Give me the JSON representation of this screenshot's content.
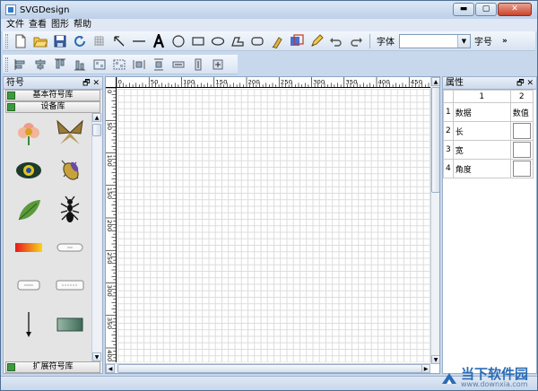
{
  "window": {
    "title": "SVGDesign",
    "min_glyph": "▬",
    "max_glyph": "▢",
    "close_glyph": "✕"
  },
  "menu": [
    "文件",
    "查看",
    "图形",
    "帮助"
  ],
  "toolbar1": {
    "tools": [
      "new-file-icon",
      "open-folder-icon",
      "save-icon",
      "refresh-icon",
      "grid-icon",
      "select-arrow-icon",
      "line-icon",
      "text-tool-icon",
      "circle-icon",
      "rectangle-icon",
      "ellipse-icon",
      "polygon-icon",
      "rounded-rect-icon",
      "path-pen-icon",
      "image-tool-icon",
      "pencil-icon",
      "undo-icon",
      "redo-icon"
    ],
    "font_label": "字体",
    "font_value": "",
    "size_label": "字号",
    "overflow": "»"
  },
  "toolbar2": {
    "tools": [
      "align-left-icon",
      "align-center-h-icon",
      "align-top-icon",
      "align-bottom-icon",
      "group-icon",
      "ungroup-icon",
      "distribute-h-icon",
      "distribute-v-icon",
      "same-width-icon",
      "same-height-icon",
      "same-size-icon"
    ]
  },
  "left_panel": {
    "title": "符号",
    "controls": "🗗 ✕",
    "libraries": [
      "基本符号库",
      "设备库",
      "扩展符号库"
    ]
  },
  "symbols": [
    "flower",
    "moth",
    "eye",
    "beetle",
    "leaf",
    "ant",
    "gradient-bar",
    "rounded-button",
    "small-button",
    "form-button",
    "down-arrow",
    "gradient-rect"
  ],
  "ruler": {
    "h_ticks": [
      "0",
      "50",
      "100",
      "150",
      "200",
      "250",
      "300",
      "350",
      "400",
      "450"
    ],
    "v_ticks": [
      "0",
      "50",
      "100",
      "150",
      "200",
      "250",
      "300",
      "350",
      "400"
    ]
  },
  "properties": {
    "title": "属性",
    "controls": "🗗 ✕",
    "col_headers": [
      "1",
      "2"
    ],
    "rows": [
      {
        "num": "1",
        "name": "数据",
        "value": "数值"
      },
      {
        "num": "2",
        "name": "长",
        "value": ""
      },
      {
        "num": "3",
        "name": "宽",
        "value": ""
      },
      {
        "num": "4",
        "name": "角度",
        "value": ""
      }
    ]
  },
  "watermark": {
    "main": "当下软件园",
    "url": "www.downxia.com"
  },
  "colors": {
    "accent": "#2b6cb5",
    "title_bar": "#bcd0e8",
    "grid_line": "#dcdcdc"
  }
}
